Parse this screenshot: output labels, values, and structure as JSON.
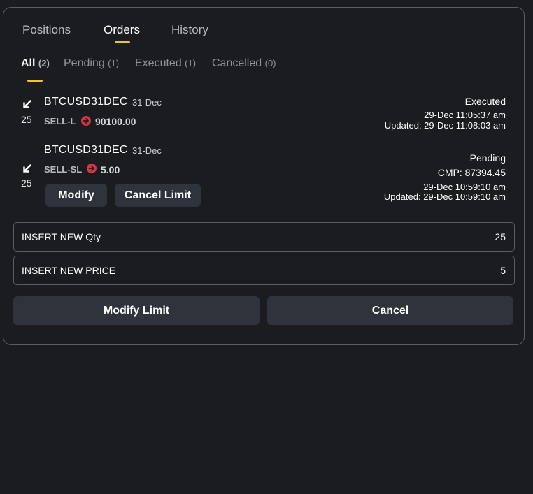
{
  "tabs": [
    {
      "label": "Positions"
    },
    {
      "label": "Orders"
    },
    {
      "label": "History"
    }
  ],
  "active_tab": "Orders",
  "subtabs": [
    {
      "label": "All",
      "count": "(2)"
    },
    {
      "label": "Pending",
      "count": "(1)"
    },
    {
      "label": "Executed",
      "count": "(1)"
    },
    {
      "label": "Cancelled",
      "count": "(0)"
    }
  ],
  "active_subtab": "All",
  "orders": [
    {
      "qty": "25",
      "symbol": "BTCUSD31DEC",
      "expiry": "31-Dec",
      "order_type": "SELL-L",
      "price": "90100.00",
      "status": "Executed",
      "time": "29-Dec 11:05:37 am",
      "updated": "Updated: 29-Dec 11:08:03 am"
    },
    {
      "qty": "25",
      "symbol": "BTCUSD31DEC",
      "expiry": "31-Dec",
      "order_type": "SELL-SL",
      "price": "5.00",
      "status": "Pending",
      "cmp": "CMP: 87394.45",
      "time": "29-Dec 10:59:10 am",
      "updated": "Updated: 29-Dec 10:59:10 am",
      "modify_label": "Modify",
      "cancel_limit_label": "Cancel Limit"
    }
  ],
  "form": {
    "qty_label": "INSERT NEW Qty",
    "qty_value": "25",
    "price_label": "INSERT NEW PRICE",
    "price_value": "5",
    "modify_limit_label": "Modify Limit",
    "cancel_label": "Cancel"
  },
  "colors": {
    "accent": "#f2c230",
    "background": "#1b1c20",
    "button": "#2f343c",
    "sell_icon": "#d9343f"
  },
  "icons": {
    "direction": "arrow-down-left-icon",
    "price_marker": "arrow-right-circle-icon"
  }
}
